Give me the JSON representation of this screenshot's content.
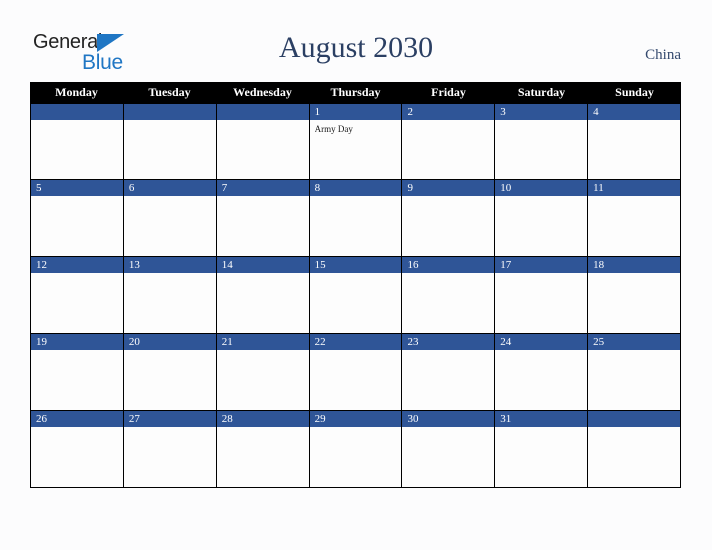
{
  "brand": {
    "name_part1": "General",
    "name_part2": "Blue",
    "triangle_color": "#1f76c4"
  },
  "header": {
    "title": "August 2030",
    "country": "China"
  },
  "theme": {
    "weekday_header_bg": "#000000",
    "weekday_header_text": "#ffffff",
    "day_band_bg": "#2f5597",
    "day_number_text": "#ffffff",
    "grid_line": "#000000",
    "page_bg": "#fcfcfd",
    "title_color": "#2b3f63"
  },
  "calendar": {
    "month": "August",
    "year": "2030",
    "weekdays": [
      "Monday",
      "Tuesday",
      "Wednesday",
      "Thursday",
      "Friday",
      "Saturday",
      "Sunday"
    ],
    "weeks": [
      [
        {
          "day": "",
          "events": []
        },
        {
          "day": "",
          "events": []
        },
        {
          "day": "",
          "events": []
        },
        {
          "day": "1",
          "events": [
            "Army Day"
          ]
        },
        {
          "day": "2",
          "events": []
        },
        {
          "day": "3",
          "events": []
        },
        {
          "day": "4",
          "events": []
        }
      ],
      [
        {
          "day": "5",
          "events": []
        },
        {
          "day": "6",
          "events": []
        },
        {
          "day": "7",
          "events": []
        },
        {
          "day": "8",
          "events": []
        },
        {
          "day": "9",
          "events": []
        },
        {
          "day": "10",
          "events": []
        },
        {
          "day": "11",
          "events": []
        }
      ],
      [
        {
          "day": "12",
          "events": []
        },
        {
          "day": "13",
          "events": []
        },
        {
          "day": "14",
          "events": []
        },
        {
          "day": "15",
          "events": []
        },
        {
          "day": "16",
          "events": []
        },
        {
          "day": "17",
          "events": []
        },
        {
          "day": "18",
          "events": []
        }
      ],
      [
        {
          "day": "19",
          "events": []
        },
        {
          "day": "20",
          "events": []
        },
        {
          "day": "21",
          "events": []
        },
        {
          "day": "22",
          "events": []
        },
        {
          "day": "23",
          "events": []
        },
        {
          "day": "24",
          "events": []
        },
        {
          "day": "25",
          "events": []
        }
      ],
      [
        {
          "day": "26",
          "events": []
        },
        {
          "day": "27",
          "events": []
        },
        {
          "day": "28",
          "events": []
        },
        {
          "day": "29",
          "events": []
        },
        {
          "day": "30",
          "events": []
        },
        {
          "day": "31",
          "events": []
        },
        {
          "day": "",
          "events": []
        }
      ]
    ]
  }
}
